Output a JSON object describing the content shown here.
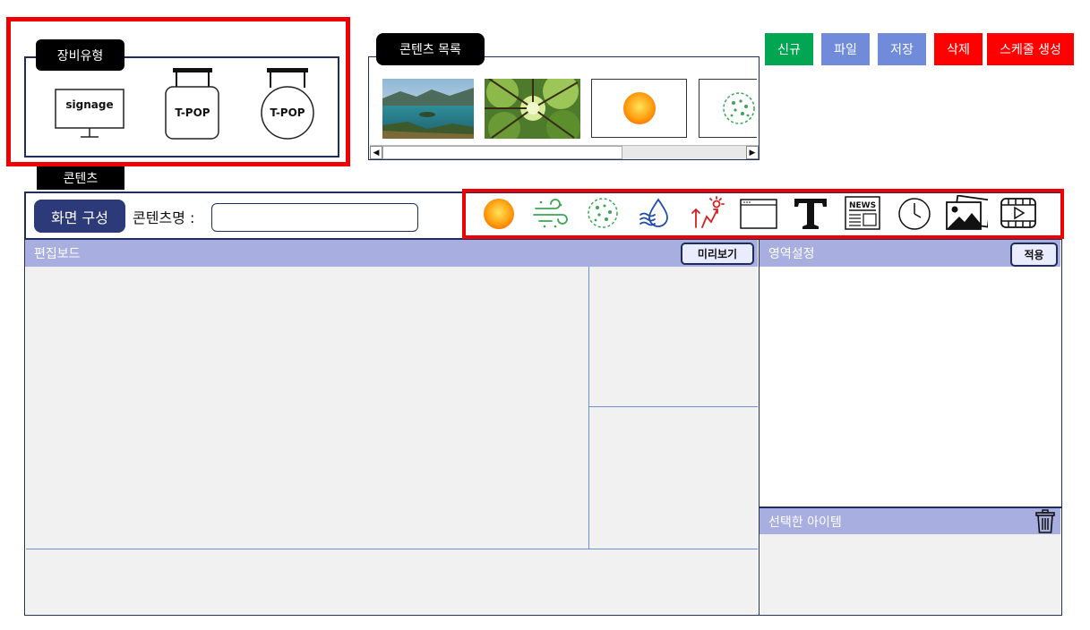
{
  "device_section": {
    "title": "장비유형",
    "devices": [
      {
        "label": "signage",
        "icon": "monitor-icon"
      },
      {
        "label": "T-POP",
        "icon": "hanging-sign-rect-icon"
      },
      {
        "label": "T-POP",
        "icon": "hanging-sign-round-icon"
      }
    ]
  },
  "content_list": {
    "title": "콘텐츠 목록",
    "items": [
      {
        "icon": "lake-landscape-image"
      },
      {
        "icon": "forest-canopy-image"
      },
      {
        "icon": "sun-icon"
      },
      {
        "icon": "dust-icon"
      }
    ]
  },
  "toolbar": {
    "buttons": [
      {
        "label": "신규",
        "color": "#00a651"
      },
      {
        "label": "파일",
        "color": "#6f8bd9"
      },
      {
        "label": "저장",
        "color": "#6f8bd9"
      },
      {
        "label": "삭제",
        "color": "#ff0000"
      },
      {
        "label": "스케줄 생성",
        "color": "#ff0000"
      }
    ]
  },
  "content_section": {
    "tab_label": "콘텐츠",
    "compose_button": "화면 구성",
    "name_label": "콘텐츠명 :",
    "name_value": "",
    "widget_icons": [
      "sun-icon",
      "wind-icon",
      "dust-icon",
      "humidity-icon",
      "uv-index-icon",
      "window-icon",
      "text-icon",
      "news-icon",
      "clock-icon",
      "image-icon",
      "video-icon"
    ]
  },
  "edit_board": {
    "title": "편집보드",
    "preview_button": "미리보기"
  },
  "area_settings": {
    "title": "영역설정",
    "apply_button": "적용"
  },
  "selected_items": {
    "title": "선택한 아이템",
    "icon": "trash-icon"
  },
  "colors": {
    "accent_navy": "#1f2d5a",
    "panel_header": "#a8aee0",
    "highlight_red": "#ee0000"
  }
}
